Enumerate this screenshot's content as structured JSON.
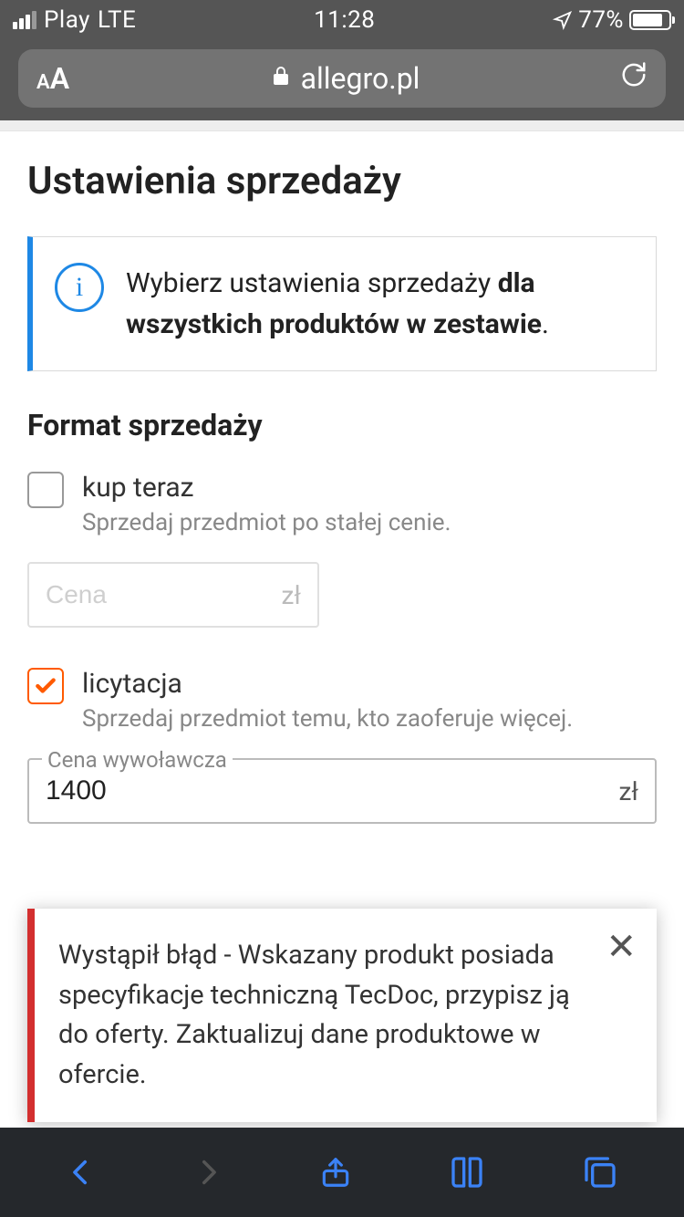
{
  "status_bar": {
    "carrier": "Play",
    "network": "LTE",
    "time": "11:28",
    "battery_percent": "77%"
  },
  "browser": {
    "text_size_label": "AA",
    "domain": "allegro.pl"
  },
  "page": {
    "title": "Ustawienia sprzedaży",
    "info_prefix": "Wybierz ustawienia sprzedaży ",
    "info_bold": "dla wszystkich produktów w zestawie",
    "info_suffix": ".",
    "section_title": "Format sprzedaży",
    "option_buy_now": {
      "label": "kup teraz",
      "desc": "Sprzedaj przedmiot po stałej cenie.",
      "checked": false
    },
    "price_field": {
      "placeholder": "Cena",
      "suffix": "zł",
      "value": ""
    },
    "option_auction": {
      "label": "licytacja",
      "desc": "Sprzedaj przedmiot temu, kto zaoferuje więcej.",
      "checked": true
    },
    "start_price_field": {
      "label": "Cena wywoławcza",
      "value": "1400",
      "suffix": "zł"
    },
    "error_toast": "Wystąpił błąd - Wskazany produkt posiada specyfikacje techniczną TecDoc, przypisz ją do oferty. Zaktualizuj dane produktowe w ofercie."
  }
}
